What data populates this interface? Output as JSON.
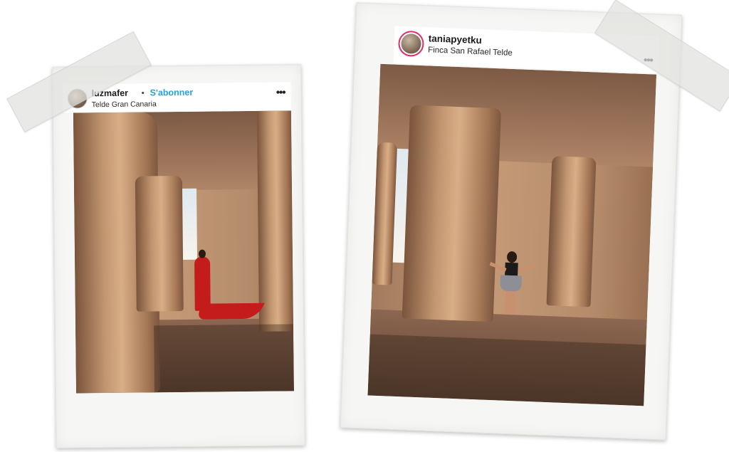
{
  "posts": [
    {
      "username": "luzmafer",
      "separator": "•",
      "subscribe_label": "S'abonner",
      "location": "Telde Gran Canaria",
      "more_icon": "more-horizontal-icon",
      "more_glyph": "•••",
      "photo_description_icon": "cave-photo"
    },
    {
      "username": "taniapyetku",
      "location": "Finca San Rafael Telde",
      "more_icon": "more-horizontal-icon",
      "more_glyph": "•••",
      "photo_description_icon": "cave-photo"
    }
  ],
  "colors": {
    "subscribe": "#2a9fd8",
    "story_ring": "#e1306c",
    "dress": "#c41c1c"
  }
}
